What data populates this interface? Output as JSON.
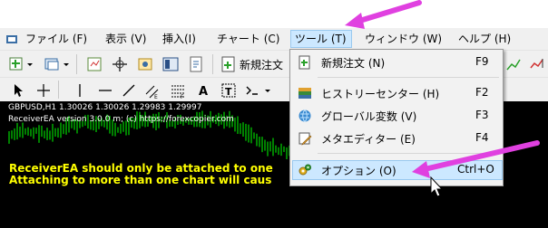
{
  "menubar": {
    "items": [
      {
        "label": "ファイル (F)"
      },
      {
        "label": "表示 (V)"
      },
      {
        "label": "挿入(I)"
      },
      {
        "label": "チャート (C)"
      },
      {
        "label": "ツール (T)"
      },
      {
        "label": "ウィンドウ (W)"
      },
      {
        "label": "ヘルプ (H)"
      }
    ]
  },
  "toolbar": {
    "new_order_label": "新規注文"
  },
  "chart": {
    "title": "GBPUSD,H1  1.30026 1.30026 1.29983 1.29997",
    "subtitle": "ReceiverEA version 3.0.0 m; (c) https://forexcopier.com",
    "warning_line1": "ReceiverEA should only be attached to one",
    "warning_line2": "Attaching to more than one chart will caus",
    "colors": {
      "background": "#000000",
      "candles": "#00ff00",
      "warning_text": "#ffff00"
    }
  },
  "tools_menu": {
    "items": [
      {
        "label": "新規注文 (N)",
        "shortcut": "F9",
        "icon": "new-order-icon"
      },
      {
        "label": "ヒストリーセンター (H)",
        "shortcut": "F2",
        "icon": "history-center-icon"
      },
      {
        "label": "グローバル変数 (V)",
        "shortcut": "F3",
        "icon": "global-variables-icon"
      },
      {
        "label": "メタエディター (E)",
        "shortcut": "F4",
        "icon": "metaeditor-icon"
      },
      {
        "label": "オプション (O)",
        "shortcut": "Ctrl+O",
        "icon": "options-icon"
      }
    ]
  },
  "colors": {
    "annotation_arrow": "#e040e0",
    "menu_highlight": "#cce8ff"
  }
}
